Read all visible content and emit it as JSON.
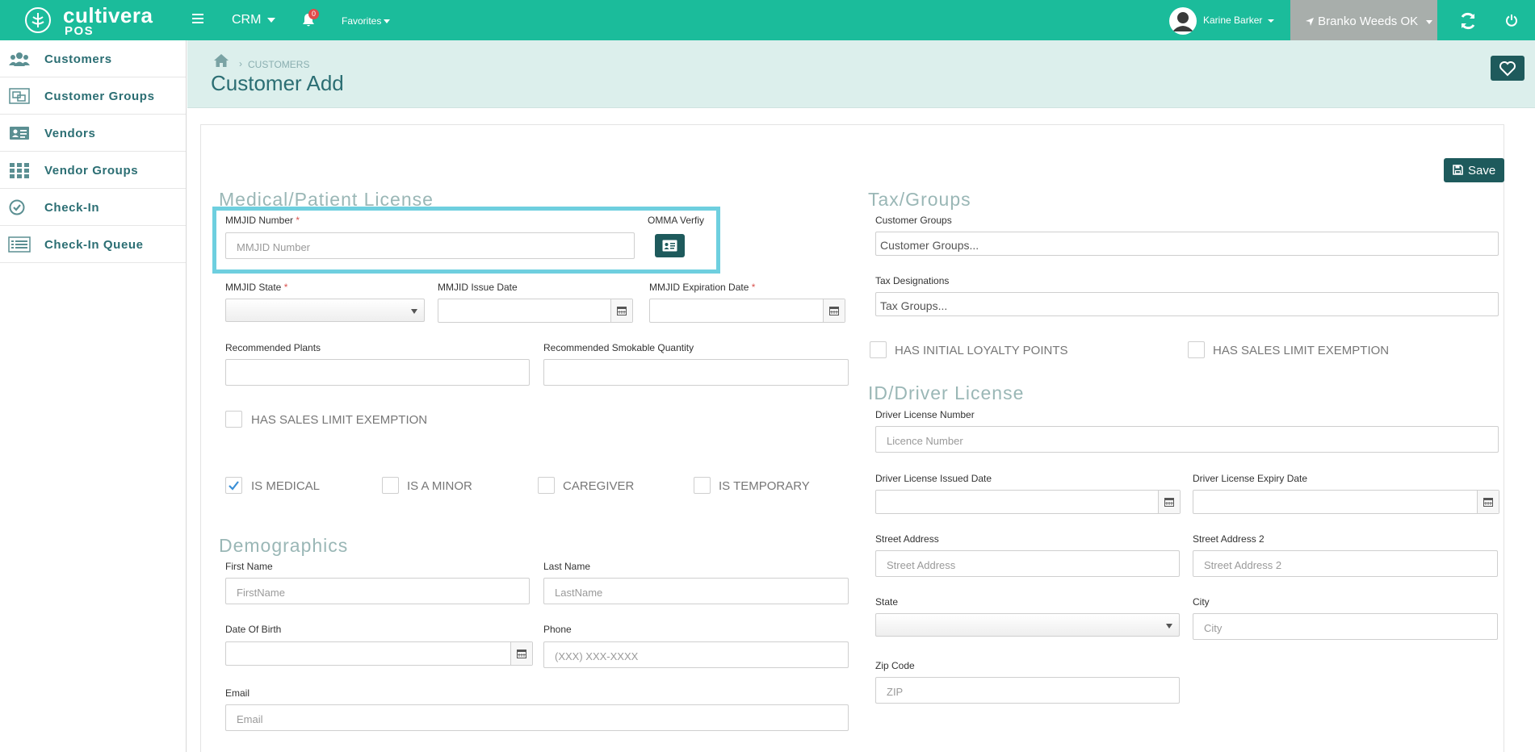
{
  "topbar": {
    "logo_name": "cultivera",
    "logo_sub": "POS",
    "crm_label": "CRM",
    "notification_count": "0",
    "favorites_label": "Favorites",
    "user_name": "Karine Barker",
    "location_label": "Branko Weeds OK"
  },
  "sidebar": {
    "items": [
      {
        "label": "Customers",
        "icon": "users-icon"
      },
      {
        "label": "Customer Groups",
        "icon": "group-icon"
      },
      {
        "label": "Vendors",
        "icon": "id-card-icon"
      },
      {
        "label": "Vendor Groups",
        "icon": "grid-icon"
      },
      {
        "label": "Check-In",
        "icon": "check-circle-icon"
      },
      {
        "label": "Check-In Queue",
        "icon": "list-icon"
      }
    ]
  },
  "header": {
    "breadcrumb_sep": "›",
    "breadcrumb": "CUSTOMERS",
    "title": "Customer Add"
  },
  "actions": {
    "save_label": "Save"
  },
  "medical": {
    "section_title": "Medical/Patient License",
    "mmjid_number_label": "MMJID Number",
    "mmjid_number_placeholder": "MMJID Number",
    "omma_label": "OMMA Verfiy",
    "mmjid_state_label": "MMJID State",
    "mmjid_issue_label": "MMJID Issue Date",
    "mmjid_expiration_label": "MMJID Expiration Date",
    "recommended_plants_label": "Recommended Plants",
    "recommended_smokable_label": "Recommended Smokable Quantity",
    "sales_limit_label": "HAS SALES LIMIT EXEMPTION",
    "is_medical_label": "IS MEDICAL",
    "is_minor_label": "IS A MINOR",
    "caregiver_label": "CAREGIVER",
    "is_temporary_label": "IS TEMPORARY",
    "required_mark": "*"
  },
  "demographics": {
    "section_title": "Demographics",
    "first_name_label": "First Name",
    "first_name_placeholder": "FirstName",
    "last_name_label": "Last Name",
    "last_name_placeholder": "LastName",
    "dob_label": "Date Of Birth",
    "phone_label": "Phone",
    "phone_placeholder": "(XXX) XXX-XXXX",
    "email_label": "Email",
    "email_placeholder": "Email"
  },
  "tax": {
    "section_title": "Tax/Groups",
    "customer_groups_label": "Customer Groups",
    "customer_groups_value": "Customer Groups...",
    "tax_designations_label": "Tax Designations",
    "tax_designations_value": "Tax Groups...",
    "initial_loyalty_label": "HAS INITIAL LOYALTY POINTS",
    "sales_limit_label": "HAS SALES LIMIT EXEMPTION"
  },
  "driver_license": {
    "section_title": "ID/Driver License",
    "number_label": "Driver License Number",
    "number_placeholder": "Licence Number",
    "issued_label": "Driver License Issued Date",
    "expiry_label": "Driver License Expiry Date",
    "street_label": "Street Address",
    "street_placeholder": "Street Address",
    "street2_label": "Street Address 2",
    "street2_placeholder": "Street Address 2",
    "state_label": "State",
    "city_label": "City",
    "city_placeholder": "City",
    "zip_label": "Zip Code",
    "zip_placeholder": "ZIP"
  },
  "colors": {
    "topbar": "#1bbc9b",
    "accent_dark": "#1e5a5c",
    "highlight": "#6ecfdf"
  }
}
